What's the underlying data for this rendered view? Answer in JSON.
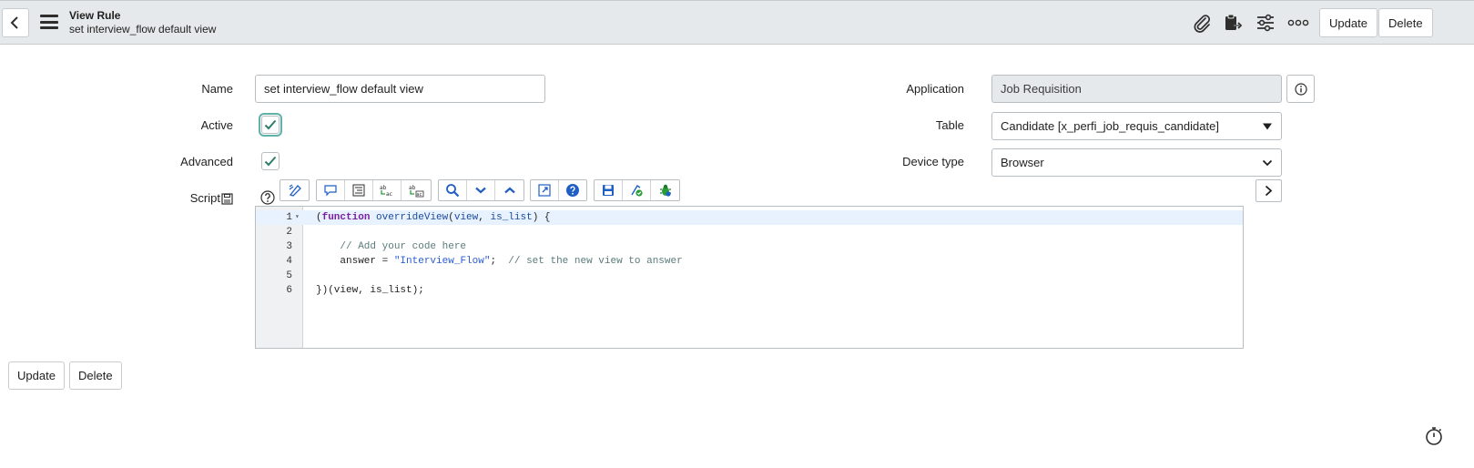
{
  "header": {
    "title": "View Rule",
    "subtitle": "set interview_flow default view",
    "update_label": "Update",
    "delete_label": "Delete"
  },
  "form": {
    "name_label": "Name",
    "name_value": "set interview_flow default view",
    "active_label": "Active",
    "active_checked": true,
    "advanced_label": "Advanced",
    "advanced_checked": true,
    "script_label": "Script",
    "application_label": "Application",
    "application_value": "Job Requisition",
    "table_label": "Table",
    "table_value": "Candidate [x_perfi_job_requis_candidate]",
    "device_type_label": "Device type",
    "device_type_value": "Browser"
  },
  "editor": {
    "line_numbers": [
      "1",
      "2",
      "3",
      "4",
      "5",
      "6"
    ],
    "lines": {
      "l1_open": "(",
      "l1_kw": "function",
      "l1_sp": " ",
      "l1_fn": "overrideView",
      "l1_paren": "(",
      "l1_a1": "view",
      "l1_comma": ", ",
      "l1_a2": "is_list",
      "l1_close": ") {",
      "l3_comment": "    // Add your code here",
      "l4_pre": "    answer = ",
      "l4_str": "\"Interview_Flow\"",
      "l4_mid": ";  ",
      "l4_comment": "// set the new view to answer",
      "l6": "})(view, is_list);"
    }
  },
  "footer": {
    "update_label": "Update",
    "delete_label": "Delete"
  },
  "colors": {
    "header_bg": "#e6e9eb",
    "check_green": "#2e7d6b",
    "focus_ring": "#5eb2a8"
  }
}
